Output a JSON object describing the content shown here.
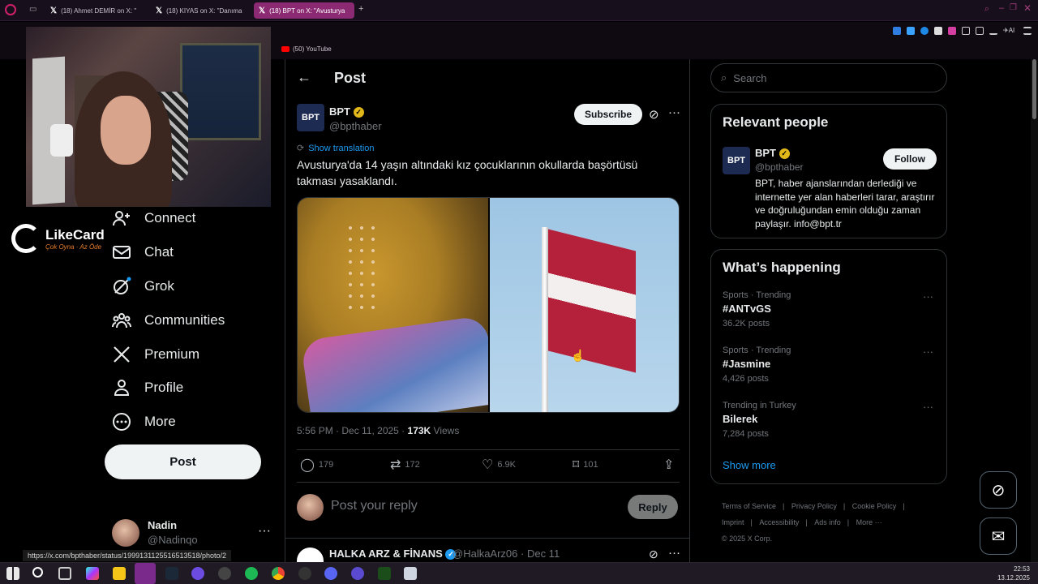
{
  "browser": {
    "tabs": [
      {
        "label": "(18) Ahmet DEMİR on X: \"",
        "active": false
      },
      {
        "label": "(18) KIYAS on X: \"Danıma",
        "active": false
      },
      {
        "label": "(18) BPT on X: \"Avusturya",
        "active": true
      }
    ],
    "new_tab": "+",
    "bookmark": "(50) YouTube",
    "status_url": "https://x.com/bpthaber/status/1999131125516513518/photo/2"
  },
  "overlay": {
    "likecard_name": "LikeCard",
    "likecard_tagline": "Çok Oyna · Az Öde"
  },
  "nav": {
    "items": [
      {
        "label": "Connect",
        "icon": "person-plus-icon"
      },
      {
        "label": "Chat",
        "icon": "mail-icon"
      },
      {
        "label": "Grok",
        "icon": "grok-icon"
      },
      {
        "label": "Communities",
        "icon": "people-icon"
      },
      {
        "label": "Premium",
        "icon": "x-logo-icon"
      },
      {
        "label": "Profile",
        "icon": "person-icon"
      },
      {
        "label": "More",
        "icon": "more-circle-icon"
      }
    ],
    "post_button": "Post",
    "account": {
      "name": "Nadin",
      "handle": "@Nadinqo",
      "more": "···"
    }
  },
  "header": {
    "back": "←",
    "title": "Post"
  },
  "tweet": {
    "avatar_text": "BPT",
    "author_name": "BPT",
    "author_handle": "@bpthaber",
    "subscribe": "Subscribe",
    "show_translation": "Show translation",
    "text": "Avusturya'da 14 yaşın altındaki kız çocuklarının okullarda başörtüsü takması yasaklandı.",
    "time": "5:56 PM · Dec 11, 2025 · ",
    "views_count": "173K",
    "views_label": " Views",
    "replies": "179",
    "reposts": "172",
    "likes": "6.9K",
    "bookmarks": "101"
  },
  "reply": {
    "placeholder": "Post your reply",
    "button": "Reply"
  },
  "next_post": {
    "name": "HALKA ARZ & FİNANS",
    "handle": "@HalkaArz06 · Dec 11"
  },
  "search": {
    "placeholder": "Search"
  },
  "relevant": {
    "heading": "Relevant people",
    "name": "BPT",
    "handle": "@bpthaber",
    "follow": "Follow",
    "bio": "BPT, haber ajanslarından derlediği ve internette yer alan haberleri tarar, araştırır ve doğruluğundan emin olduğu zaman paylaşır. info@bpt.tr"
  },
  "happening": {
    "heading": "What’s happening",
    "trends": [
      {
        "context": "Sports · Trending",
        "title": "#ANTvGS",
        "posts": "36.2K posts"
      },
      {
        "context": "Sports · Trending",
        "title": "#Jasmine",
        "posts": "4,426 posts"
      },
      {
        "context": "Trending in Turkey",
        "title": "Bilerek",
        "posts": "7,284 posts"
      }
    ],
    "show_more": "Show more"
  },
  "footer": {
    "links": [
      "Terms of Service",
      "Privacy Policy",
      "Cookie Policy",
      "Imprint",
      "Accessibility",
      "Ads info",
      "More ···"
    ],
    "copyright": "© 2025 X Corp."
  },
  "clock": {
    "time": "22:53",
    "date": "13.12.2025"
  },
  "colors": {
    "accent": "#1d9bf0",
    "tab_active": "#8b2a72",
    "verified_gold": "#e2b719"
  }
}
